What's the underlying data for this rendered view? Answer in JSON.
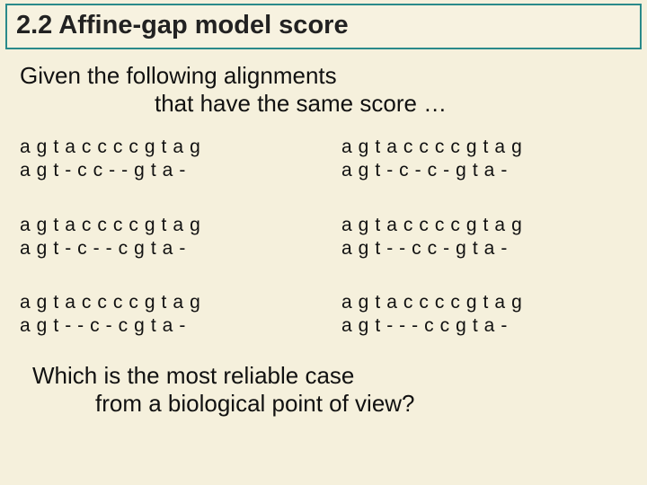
{
  "title": "2.2 Affine-gap model score",
  "intro": {
    "line1": "Given the following alignments",
    "line2": "that have the same score …"
  },
  "alignments": [
    {
      "top": "agtaccccgtag",
      "bottom": "agt-cc--gta-"
    },
    {
      "top": "agtaccccgtag",
      "bottom": "agt-c-c-gta-"
    },
    {
      "top": "agtaccccgtag",
      "bottom": "agt-c--cgta-"
    },
    {
      "top": "agtaccccgtag",
      "bottom": "agt--cc-gta-"
    },
    {
      "top": "agtaccccgtag",
      "bottom": "agt--c-cgta-"
    },
    {
      "top": "agtaccccgtag",
      "bottom": "agt---ccgta-"
    }
  ],
  "footer": {
    "line1": "Which is the most reliable case",
    "line2": "from a biological point of view?"
  }
}
